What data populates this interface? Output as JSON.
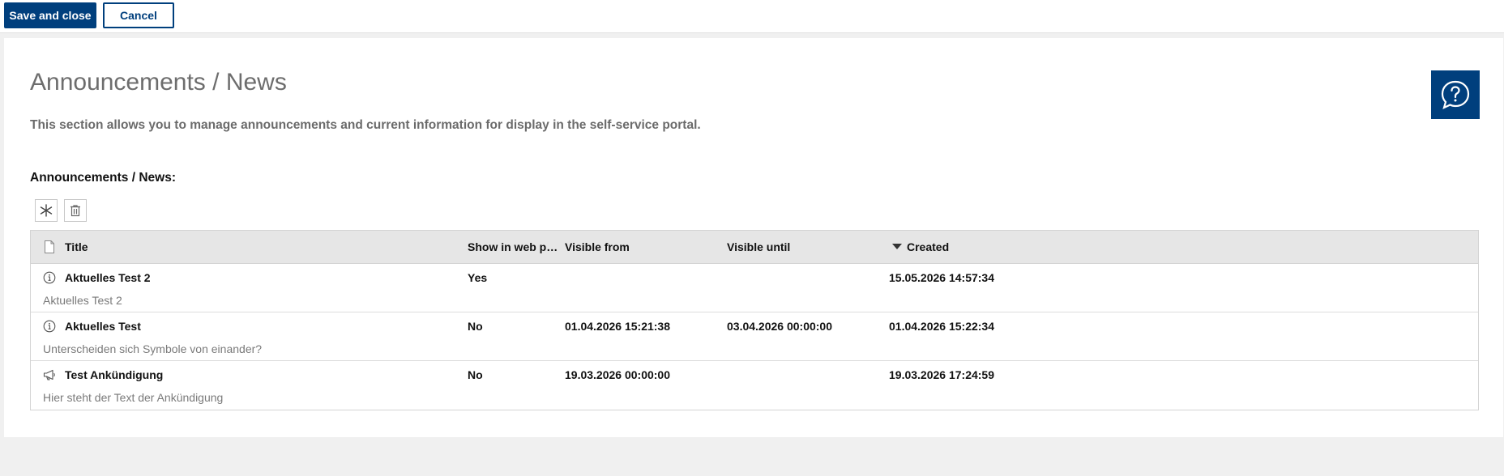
{
  "toolbar": {
    "save_label": "Save and close",
    "cancel_label": "Cancel"
  },
  "page": {
    "title": "Announcements / News",
    "description": "This section allows you to manage announcements and current information for display in the self-service portal.",
    "section_label": "Announcements / News:",
    "help_icon": "question-speech-bubble-icon"
  },
  "grid_tools": {
    "new_icon": "asterisk-icon",
    "delete_icon": "trash-icon"
  },
  "table": {
    "columns": {
      "title": "Title",
      "show_in_web_portal": "Show in web portal",
      "visible_from": "Visible from",
      "visible_until": "Visible until",
      "created": "Created"
    },
    "sort": {
      "column": "created",
      "direction": "descending"
    },
    "rows": [
      {
        "icon": "info-icon",
        "title": "Aktuelles Test 2",
        "show": "Yes",
        "from": "",
        "until": "",
        "created": "15.05.2026 14:57:34",
        "text": "Aktuelles Test 2"
      },
      {
        "icon": "info-icon",
        "title": "Aktuelles Test",
        "show": "No",
        "from": "01.04.2026 15:21:38",
        "until": "03.04.2026 00:00:00",
        "created": "01.04.2026 15:22:34",
        "text": "Unterscheiden sich Symbole von einander?"
      },
      {
        "icon": "megaphone-icon",
        "title": "Test Ankündigung",
        "show": "No",
        "from": "19.03.2026 00:00:00",
        "until": "",
        "created": "19.03.2026 17:24:59",
        "text": "Hier steht der Text der Ankündigung"
      }
    ]
  },
  "colors": {
    "primary": "#003f7d",
    "header_bg": "#e6e6e6",
    "page_bg": "#f0f0f0"
  }
}
